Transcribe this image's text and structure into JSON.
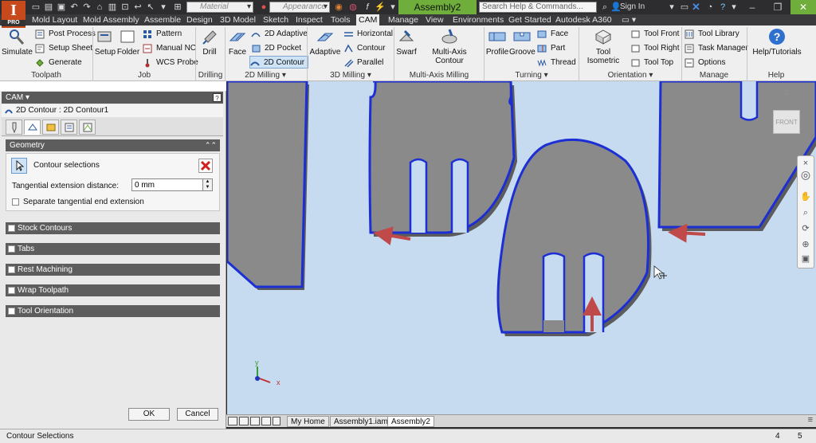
{
  "qat": {
    "material_placeholder": "Material",
    "appearance_placeholder": "Appearance",
    "document_title": "Assembly2",
    "search_placeholder": "Search Help & Commands...",
    "sign_in": "Sign In",
    "logo_letter": "I",
    "logo_badge": "PRO"
  },
  "menu_tabs": [
    "Mold Layout",
    "Mold Assembly",
    "Assemble",
    "Design",
    "3D Model",
    "Sketch",
    "Inspect",
    "Tools",
    "CAM",
    "Manage",
    "View",
    "Environments",
    "Get Started",
    "Autodesk A360"
  ],
  "active_tab": "CAM",
  "ribbon": {
    "toolpath": {
      "simulate": "Simulate",
      "post_process": "Post Process",
      "setup_sheet": "Setup Sheet",
      "generate": "Generate",
      "label": "Toolpath"
    },
    "job": {
      "setup": "Setup",
      "folder": "Folder",
      "pattern": "Pattern",
      "manual_nc": "Manual NC",
      "wcs_probe": "WCS Probe",
      "label": "Job"
    },
    "drilling": {
      "drill": "Drill",
      "label": "Drilling"
    },
    "milling2d": {
      "face": "Face",
      "adaptive": "2D Adaptive",
      "pocket": "2D Pocket",
      "contour": "2D Contour",
      "label": "2D Milling ▾"
    },
    "milling3d": {
      "adaptive": "Adaptive",
      "horizontal": "Horizontal",
      "contour": "Contour",
      "parallel": "Parallel",
      "label": "3D Milling ▾"
    },
    "multiaxis": {
      "swarf": "Swarf",
      "multi_axis_contour": "Multi-Axis Contour",
      "label": "Multi-Axis Milling"
    },
    "turning": {
      "profile": "Profile",
      "groove": "Groove",
      "face": "Face",
      "part": "Part",
      "thread": "Thread",
      "label": "Turning ▾"
    },
    "orientation": {
      "tool_isometric": "Tool Isometric",
      "tool_front": "Tool Front",
      "tool_right": "Tool Right",
      "tool_top": "Tool Top",
      "label": "Orientation ▾"
    },
    "manage": {
      "tool_library": "Tool Library",
      "task_manager": "Task Manager",
      "options": "Options",
      "label": "Manage"
    },
    "help": {
      "help_tutorials": "Help/Tutorials",
      "label": "Help"
    }
  },
  "panel": {
    "header": "CAM ▾",
    "operation_title": "2D Contour : 2D Contour1",
    "geometry": {
      "title": "Geometry",
      "contour_selections": "Contour selections",
      "tangential_label": "Tangential extension distance:",
      "tangential_value": "0 mm",
      "separate_label": "Separate tangential end extension"
    },
    "sections": [
      "Stock Contours",
      "Tabs",
      "Rest Machining",
      "Wrap Toolpath",
      "Tool Orientation"
    ],
    "ok": "OK",
    "cancel": "Cancel"
  },
  "viewport": {
    "viewcube_label": "FRONT",
    "axis_y": "y",
    "axis_x": "x"
  },
  "doc_tabs": [
    "My Home",
    "Assembly1.iam",
    "Assembly2"
  ],
  "active_doc": "Assembly2",
  "status": {
    "text": "Contour Selections",
    "count_a": "4",
    "count_b": "5"
  },
  "colors": {
    "accent": "#6fae3a",
    "contour": "#1b2fd4",
    "part": "#8a8a8a",
    "viewport_bg": "#c6dbf0",
    "arrow": "#c04a4a"
  }
}
